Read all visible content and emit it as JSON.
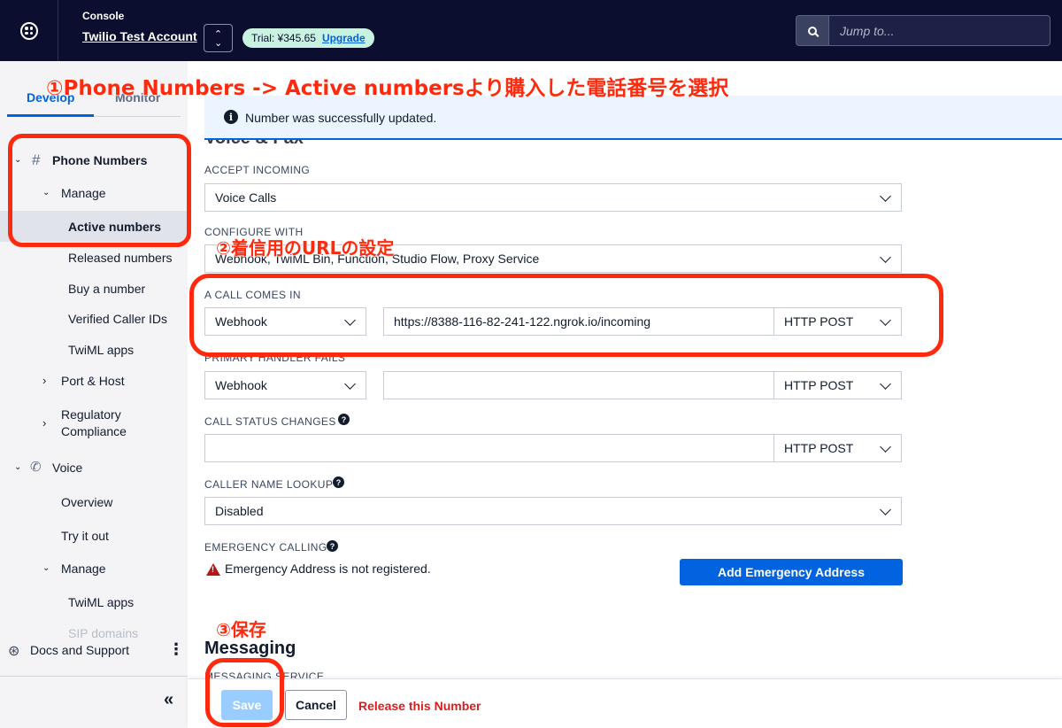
{
  "header": {
    "console_label": "Console",
    "account_name": "Twilio Test Account",
    "trial_text": "Trial: ¥345.65",
    "upgrade_label": "Upgrade",
    "search_placeholder": "Jump to..."
  },
  "sidebar": {
    "tabs": [
      "Develop",
      "Monitor"
    ],
    "phone_numbers": "Phone Numbers",
    "manage": "Manage",
    "items": [
      "Active numbers",
      "Released numbers",
      "Buy a number",
      "Verified Caller IDs",
      "TwiML apps"
    ],
    "port_host": "Port & Host",
    "regulatory_1": "Regulatory",
    "regulatory_2": "Compliance",
    "voice": "Voice",
    "overview": "Overview",
    "try_it_out": "Try it out",
    "voice_manage": "Manage",
    "voice_twiml_apps": "TwiML apps",
    "sip_domains": "SIP domains",
    "docs_support": "Docs and Support"
  },
  "notification": "Number was successfully updated.",
  "section_voice": "Voice & Fax",
  "form": {
    "accept_incoming_label": "ACCEPT INCOMING",
    "accept_incoming_value": "Voice Calls",
    "configure_with_label": "CONFIGURE WITH",
    "configure_with_value": "Webhook, TwiML Bin, Function, Studio Flow, Proxy Service",
    "call_comes_in_label": "A CALL COMES IN",
    "call_comes_in_type": "Webhook",
    "call_comes_in_url": "https://8388-116-82-241-122.ngrok.io/incoming",
    "call_comes_in_method": "HTTP POST",
    "primary_fails_label": "PRIMARY HANDLER FAILS",
    "primary_fails_type": "Webhook",
    "primary_fails_url": "",
    "primary_fails_method": "HTTP POST",
    "status_changes_label": "CALL STATUS CHANGES",
    "status_changes_url": "",
    "status_changes_method": "HTTP POST",
    "caller_name_label": "CALLER NAME LOOKUP",
    "caller_name_value": "Disabled",
    "emergency_label": "EMERGENCY CALLING",
    "emergency_warning": "Emergency Address is not registered.",
    "emergency_button": "Add Emergency Address"
  },
  "section_messaging": "Messaging",
  "messaging_service_label": "MESSAGING SERVICE",
  "footer": {
    "save": "Save",
    "cancel": "Cancel",
    "release": "Release this Number"
  },
  "annotations": {
    "step1": "①Phone Numbers -> Active numbersより購入した電話番号を選択",
    "step2": "②着信用のURLの設定",
    "step3": "③保存"
  },
  "colors": {
    "annotation": "#ff2a0e",
    "brand_primary": "#0263e0",
    "topbar": "#0b0e2e",
    "danger": "#d61f1f"
  }
}
